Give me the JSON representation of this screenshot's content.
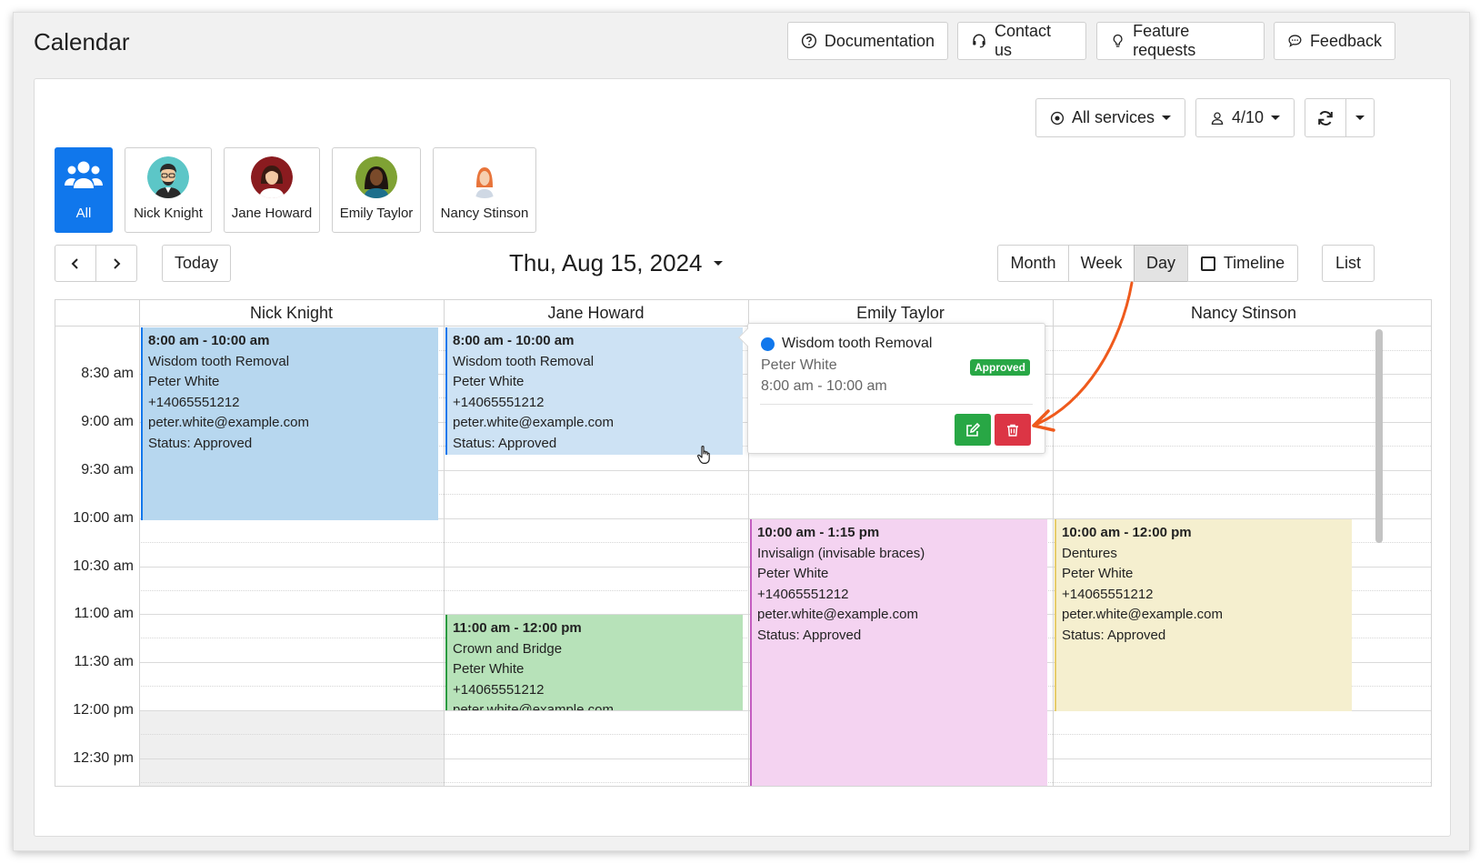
{
  "header": {
    "title": "Calendar",
    "buttons": {
      "documentation": "Documentation",
      "contact": "Contact us",
      "feature": "Feature requests",
      "feedback": "Feedback"
    }
  },
  "toolbar": {
    "services": "All services",
    "count": "4/10"
  },
  "employees": {
    "all": "All",
    "e1": "Nick Knight",
    "e2": "Jane Howard",
    "e3": "Emily Taylor",
    "e4": "Nancy Stinson"
  },
  "nav": {
    "today": "Today",
    "date": "Thu, Aug 15, 2024",
    "month": "Month",
    "week": "Week",
    "day": "Day",
    "timeline": "Timeline",
    "list": "List"
  },
  "columns": [
    "Nick Knight",
    "Jane Howard",
    "Emily Taylor",
    "Nancy Stinson"
  ],
  "times": [
    "8:30 am",
    "9:00 am",
    "9:30 am",
    "10:00 am",
    "10:30 am",
    "11:00 am",
    "11:30 am",
    "12:00 pm",
    "12:30 pm"
  ],
  "events": {
    "nick": {
      "time": "8:00 am - 10:00 am",
      "service": "Wisdom tooth Removal",
      "client": "Peter White",
      "phone": "+14065551212",
      "email": "peter.white@example.com",
      "status": "Status: Approved"
    },
    "jane": {
      "time": "8:00 am - 10:00 am",
      "service": "Wisdom tooth Removal",
      "client": "Peter White",
      "phone": "+14065551212",
      "email": "peter.white@example.com",
      "status": "Status: Approved"
    },
    "jane2": {
      "time": "11:00 am - 12:00 pm",
      "service": "Crown and Bridge",
      "client": "Peter White",
      "phone": "+14065551212",
      "email": "peter.white@example.com"
    },
    "emily": {
      "time": "10:00 am - 1:15 pm",
      "service": "Invisalign (invisable braces)",
      "client": "Peter White",
      "phone": "+14065551212",
      "email": "peter.white@example.com",
      "status": "Status: Approved"
    },
    "nancy": {
      "time": "10:00 am - 12:00 pm",
      "service": "Dentures",
      "client": "Peter White",
      "phone": "+14065551212",
      "email": "peter.white@example.com",
      "status": "Status: Approved"
    }
  },
  "popup": {
    "service": "Wisdom tooth Removal",
    "client": "Peter White",
    "badge": "Approved",
    "time": "8:00 am - 10:00 am"
  },
  "colors": {
    "primary": "#1077ec",
    "approved": "#28a745",
    "danger": "#dc3545",
    "arrow": "#ef5a1c"
  }
}
